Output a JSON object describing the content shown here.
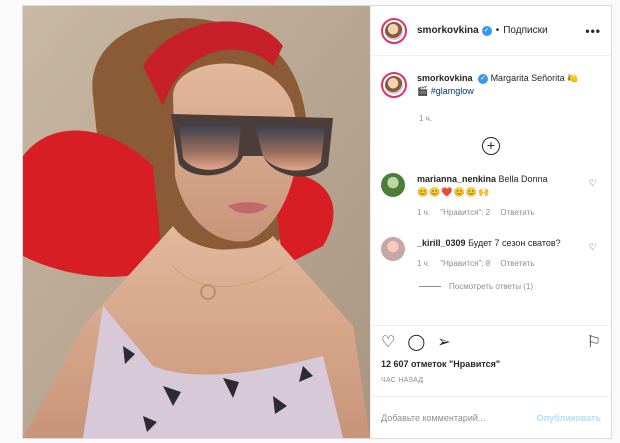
{
  "post": {
    "username": "smorkovkina",
    "follow_dot": "•",
    "follow_label": "Подписки",
    "more": "•••",
    "caption_text": "Margarita Señorita",
    "caption_emoji": "🍋",
    "caption_emoji2": "🎬",
    "caption_tag": "#glamglow",
    "time": "1 ч."
  },
  "comments": [
    {
      "username": "marianna_nenkina",
      "text": "Bella Donna",
      "emojis": "😊😊❤️😊😊🙌",
      "time": "1 ч.",
      "likes": "\"Нравится\": 2",
      "reply": "Ответить"
    },
    {
      "username": "_kirill_0309",
      "text": "Будет 7 сезон сватов?",
      "time": "1 ч.",
      "likes": "\"Нравится\": 8",
      "reply": "Ответить"
    }
  ],
  "replies_link": "Посмотреть ответы (1)",
  "likes_count": "12 607 отметок \"Нравится\"",
  "posted_ago": "ЧАС НАЗАД",
  "add_comment_placeholder": "Добавьте комментарий...",
  "publish_label": "Опубликовать",
  "colors": {
    "verified": "#3897f0",
    "link": "#00376b",
    "publish": "#b2dffc"
  }
}
